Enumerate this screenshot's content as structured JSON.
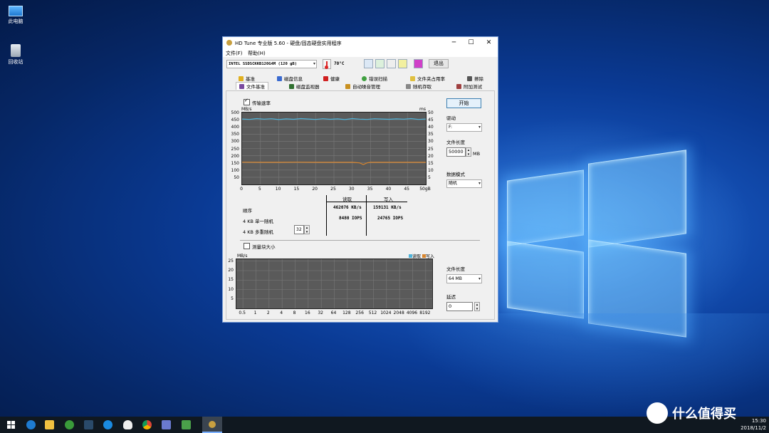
{
  "desktop": {
    "icons": [
      {
        "label": "此电脑",
        "icon": "computer-icon"
      },
      {
        "label": "回收站",
        "icon": "recycle-bin-icon"
      }
    ]
  },
  "window": {
    "title": "HD Tune 专业版 5.60 - 硬盘/固态硬盘实用程序",
    "menu": [
      "文件(F)",
      "帮助(H)"
    ],
    "drive": "INTEL SSDSCKKB120G4M (120 gB)",
    "temperature": "70°C",
    "exit_label": "退出",
    "tabs_row1": [
      "基准",
      "磁盘信息",
      "健康",
      "错误扫描",
      "文件夹占用率",
      "擦除"
    ],
    "tabs_row2": [
      "文件基准",
      "磁盘监视器",
      "自动噪音管理",
      "随机存取",
      "附加测试"
    ],
    "active_tab": "文件基准"
  },
  "file_benchmark": {
    "transfer_rate_label": "传输速率",
    "transfer_rate_checked": true,
    "start_label": "开始",
    "drive_label": "驱动",
    "drive_value": "F:",
    "file_length_label": "文件长度",
    "file_length_value": "50000",
    "file_length_unit": "MB",
    "data_mode_label": "数据模式",
    "data_mode_value": "随机",
    "results": {
      "read_header": "读取",
      "write_header": "写入",
      "rows": [
        {
          "label": "顺序",
          "read": "462076 KB/s",
          "write": "159131 KB/s"
        },
        {
          "label": "4 KB 单一随机",
          "read": "8480 IOPS",
          "write": "24765 IOPS"
        },
        {
          "label": "4 KB 多重随机",
          "read": "",
          "write": ""
        }
      ],
      "queue_depth": "32"
    },
    "block_size_label": "测量块大小",
    "block_size_checked": false,
    "file_length2_label": "文件长度",
    "file_length2_value": "64 MB",
    "delay_label": "延迟",
    "delay_value": "0"
  },
  "chart_data": [
    {
      "type": "line",
      "ylabel": "MB/s",
      "y2label": "ms",
      "ylim": [
        0,
        500
      ],
      "y2lim": [
        0,
        50
      ],
      "yticks": [
        "500",
        "450",
        "400",
        "350",
        "300",
        "250",
        "200",
        "150",
        "100",
        "50"
      ],
      "y2ticks": [
        "50",
        "45",
        "40",
        "35",
        "30",
        "25",
        "20",
        "15",
        "10",
        "5"
      ],
      "xticks": [
        "0",
        "5",
        "10",
        "15",
        "20",
        "25",
        "30",
        "35",
        "40",
        "45",
        "50gB"
      ],
      "xlim": [
        0,
        50
      ],
      "grid": true,
      "series": [
        {
          "color": "#4fb3d9",
          "x": [
            0,
            2,
            4,
            6,
            8,
            10,
            12,
            14,
            16,
            18,
            20,
            22,
            24,
            26,
            28,
            30,
            32,
            34,
            36,
            38,
            40,
            42,
            44,
            46,
            48,
            50
          ],
          "y": [
            455,
            452,
            458,
            454,
            457,
            451,
            456,
            453,
            458,
            455,
            452,
            457,
            453,
            456,
            451,
            458,
            454,
            452,
            457,
            455,
            453,
            456,
            454,
            458,
            452,
            455
          ]
        },
        {
          "color": "#d9852c",
          "x": [
            0,
            5,
            10,
            15,
            20,
            25,
            30,
            32,
            33,
            34,
            35,
            40,
            45,
            50
          ],
          "y": [
            155,
            154,
            154,
            155,
            154,
            154,
            154,
            150,
            138,
            150,
            154,
            154,
            154,
            154
          ]
        }
      ]
    },
    {
      "type": "bar",
      "ylabel": "MB/s",
      "ylim": [
        0,
        25
      ],
      "yticks": [
        "25",
        "20",
        "15",
        "10",
        "5"
      ],
      "categories": [
        "0.5",
        "1",
        "2",
        "4",
        "8",
        "16",
        "32",
        "64",
        "128",
        "256",
        "512",
        "1024",
        "2048",
        "4096",
        "8192"
      ],
      "series": [
        {
          "name": "读取",
          "color": "#4fb3d9",
          "values": []
        },
        {
          "name": "写入",
          "color": "#d9852c",
          "values": []
        }
      ],
      "legend": "top-right",
      "grid": true
    }
  ],
  "taskbar": {
    "apps": [
      "start-icon",
      "edge-icon",
      "explorer-icon",
      "xbox-icon",
      "steam-icon",
      "app-icon",
      "qq-icon",
      "chrome-icon",
      "photos-icon",
      "map-icon",
      "hdtune-icon"
    ],
    "time": "15:30",
    "date": "2018/11/2",
    "watermark": "什么值得买"
  }
}
